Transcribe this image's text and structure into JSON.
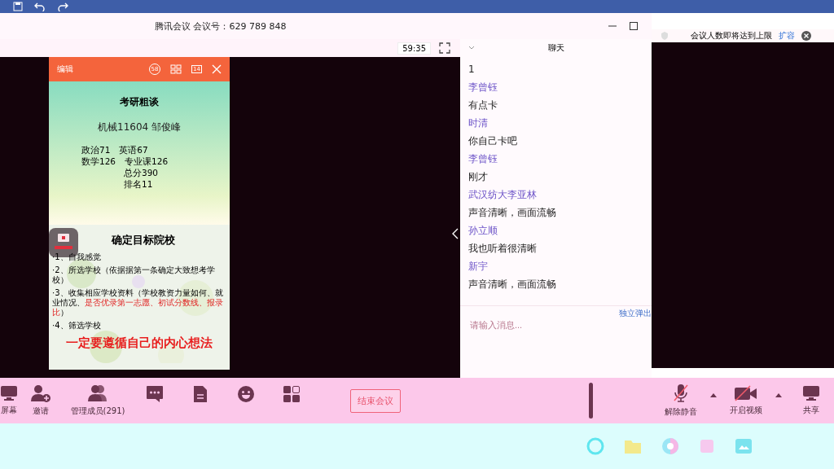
{
  "title_bar": {
    "title": "腾讯会议 会议号：629 789 848"
  },
  "timer": "59:35",
  "notice": {
    "text": "会议人数即将达到上限",
    "action": "扩容"
  },
  "slide_window": {
    "label": "编辑",
    "badge": "58",
    "page_count": "14"
  },
  "slides": [
    {
      "kind": "cover",
      "title": "考研粗谈",
      "subtitle": "机械11604 邹俊峰",
      "lines": [
        {
          "text": "政治71　英语67",
          "kind": "left"
        },
        {
          "text": "数学126　专业课126",
          "kind": "left"
        },
        {
          "text": "总分390",
          "kind": "right"
        },
        {
          "text": "排名11",
          "kind": "right"
        }
      ]
    },
    {
      "kind": "bullets",
      "title": "确定目标院校",
      "bullets": [
        {
          "text": "·1、自我感觉"
        },
        {
          "text": "·2、所选学校（依据据第一条确定大致想考学校）"
        },
        {
          "text": "·3、收集相应学校资料（学校教资力量如何、就业情况、",
          "highlight": "是否优录第一志愿、初试分数线、报录比",
          "tail": "）"
        },
        {
          "text": "·4、筛选学校"
        }
      ],
      "slogan": "一定要遵循自己的内心想法"
    }
  ],
  "chat": {
    "title": "聊天",
    "messages": [
      {
        "kind": "text",
        "text": "1"
      },
      {
        "kind": "name",
        "text": "李曾钰"
      },
      {
        "kind": "text",
        "text": "有点卡"
      },
      {
        "kind": "name",
        "text": "时清"
      },
      {
        "kind": "text",
        "text": "你自己卡吧"
      },
      {
        "kind": "name",
        "text": "李曾钰"
      },
      {
        "kind": "text",
        "text": "刚才"
      },
      {
        "kind": "name",
        "text": "武汉纺大李亚林"
      },
      {
        "kind": "text",
        "text": "声音清晰，画面流畅"
      },
      {
        "kind": "name",
        "text": "孙立顺"
      },
      {
        "kind": "text",
        "text": "我也听着很清晰"
      },
      {
        "kind": "name",
        "text": "新宇"
      },
      {
        "kind": "text",
        "text": "声音清晰，画面流畅"
      }
    ],
    "popout": "独立弹出",
    "placeholder": "请输入消息..."
  },
  "toolbar": {
    "left": [
      {
        "label": "屏幕"
      },
      {
        "label": "邀请"
      },
      {
        "label": "管理成员(291)"
      }
    ],
    "end_button": "结束会议",
    "right": [
      {
        "label": "解除静音"
      },
      {
        "label": "开启视频"
      },
      {
        "label": "共享"
      }
    ]
  }
}
